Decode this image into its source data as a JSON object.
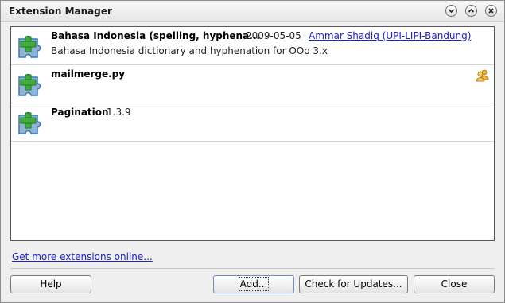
{
  "window": {
    "title": "Extension Manager"
  },
  "extensions": [
    {
      "name": "Bahasa Indonesia (spelling, hyphena...",
      "version": "2009-05-05",
      "publisher": "Ammar Shadiq (UPI-LIPI-Bandung)",
      "description": "Bahasa Indonesia dictionary and hyphenation for OOo 3.x",
      "shared": false
    },
    {
      "name": "mailmerge.py",
      "version": "",
      "publisher": "",
      "description": "",
      "shared": true
    },
    {
      "name": "Pagination",
      "version": "1.3.9",
      "publisher": "",
      "description": "",
      "shared": false
    }
  ],
  "links": {
    "get_more": "Get more extensions online..."
  },
  "buttons": {
    "help": "Help",
    "add": "Add...",
    "check_updates": "Check for Updates...",
    "close": "Close"
  },
  "icons": {
    "extension": "puzzle-piece-plus-icon",
    "shared": "shared-users-icon",
    "minimize": "chevron-down-icon",
    "maximize": "chevron-up-icon",
    "close": "close-icon"
  },
  "colors": {
    "link": "#1d22c8",
    "puzzle": "#3a78b6",
    "plus": "#3fae3a"
  }
}
